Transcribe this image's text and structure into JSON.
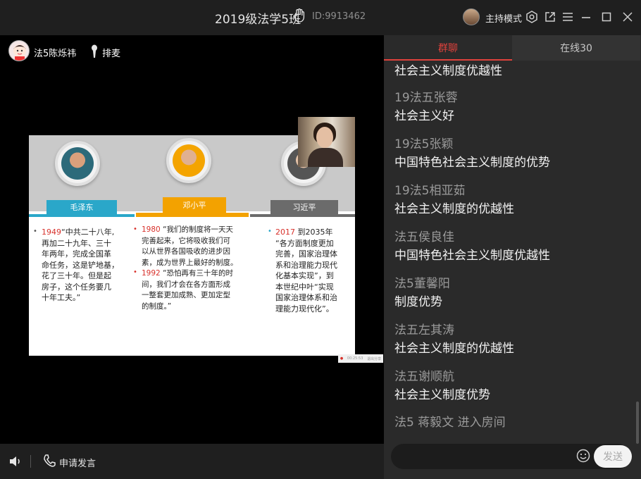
{
  "window": {
    "title": "2019级法学5班",
    "room_id": "ID:9913462",
    "host_mode": "主持模式"
  },
  "stage": {
    "user_name": "法5陈烁祎",
    "queue_label": "排麦"
  },
  "slide": {
    "leaders": [
      {
        "name": "毛泽东",
        "color": "#2aa7c9"
      },
      {
        "name": "邓小平",
        "color": "#f3a200"
      },
      {
        "name": "习近平",
        "color": "#6b6b6b"
      }
    ],
    "col1": {
      "year": "1949",
      "lines": [
        "“中共二十八年,",
        "再加二十九年、三十",
        "年两年，完成全国革",
        "命任务，这是铲地基，",
        "花了三十年。但是起",
        "房子，这个任务要几",
        "十年工夫。”"
      ]
    },
    "col2": {
      "year1": "1980",
      "lines1": [
        "“我们的制度将一天天",
        "完善起来，它将吸收我们可",
        "以从世界各国吸收的进步因",
        "素，成为世界上最好的制度。"
      ],
      "year2": "1992",
      "lines2": [
        "“恐怕再有三十年的时",
        "间，我们才会在各方面形成",
        "一整套更加成熟、更加定型",
        "的制度。”"
      ]
    },
    "col3": {
      "year": "2017",
      "lines": [
        "到2035年",
        "“各方面制度更加",
        "完善，国家治理体",
        "系和治理能力现代",
        "化基本实现”，到",
        "本世纪中叶“实现",
        "国家治理体系和治",
        "理能力现代化”。"
      ]
    },
    "status_time": "00:25:53",
    "status_exit": "退出分享"
  },
  "bottombar": {
    "apply_speak": "申请发言"
  },
  "chat": {
    "tab_chat": "群聊",
    "tab_online": "在线30",
    "partial_text": "社会主义制度优越性",
    "messages": [
      {
        "name": "19法五张蓉",
        "text": "社会主义好"
      },
      {
        "name": "19法5张颖",
        "text": "中国特色社会主义制度的优势"
      },
      {
        "name": "19法5相亚茹",
        "text": "社会主义制度的优越性"
      },
      {
        "name": "法五侯良佳",
        "text": "中国特色社会主义制度优越性"
      },
      {
        "name": "法5董馨阳",
        "text": "制度优势"
      },
      {
        "name": "法五左其涛",
        "text": "社会主义制度的优越性"
      },
      {
        "name": "法五谢顺航",
        "text": "社会主义制度优势"
      }
    ],
    "join_notice": "法5 蒋毅文 进入房间",
    "send_label": "发送"
  },
  "colors": {
    "accent": "#e0423c",
    "titlebar_bg": "#1f1f1f",
    "chat_bg": "#2a2a2a"
  }
}
